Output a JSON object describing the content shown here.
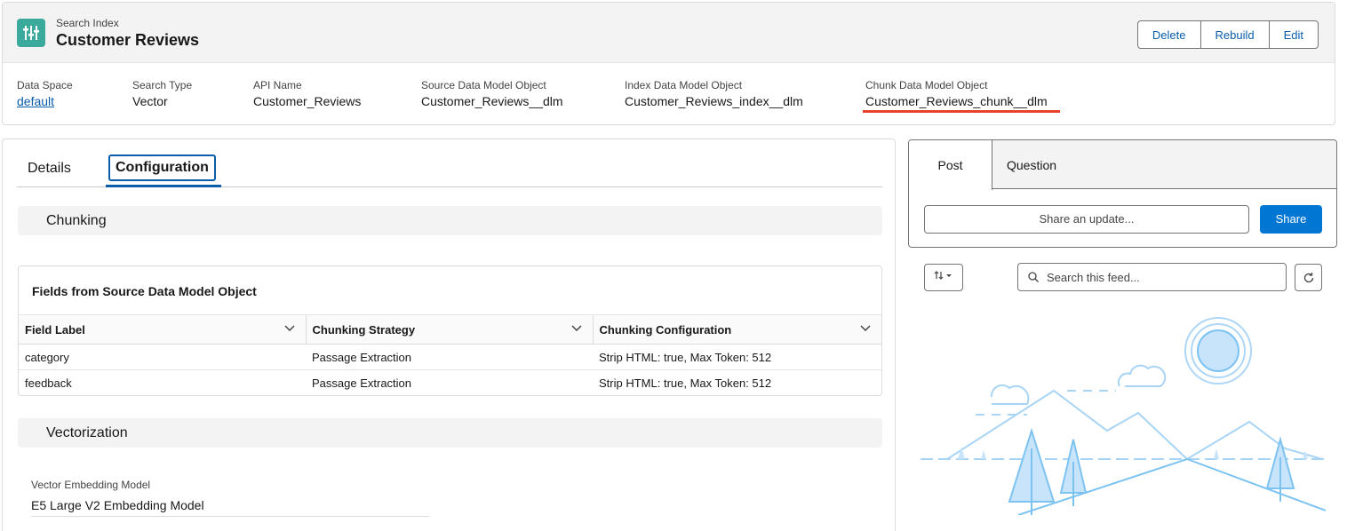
{
  "header": {
    "object_type": "Search Index",
    "title": "Customer Reviews",
    "buttons": {
      "delete": "Delete",
      "rebuild": "Rebuild",
      "edit": "Edit"
    }
  },
  "highlights": [
    {
      "label": "Data Space",
      "value": "default"
    },
    {
      "label": "Search Type",
      "value": "Vector"
    },
    {
      "label": "API Name",
      "value": "Customer_Reviews"
    },
    {
      "label": "Source Data Model Object",
      "value": "Customer_Reviews__dlm"
    },
    {
      "label": "Index Data Model Object",
      "value": "Customer_Reviews_index__dlm"
    },
    {
      "label": "Chunk Data Model Object",
      "value": "Customer_Reviews_chunk__dlm"
    }
  ],
  "tabs": {
    "details": "Details",
    "configuration": "Configuration"
  },
  "chunking": {
    "section_title": "Chunking",
    "table_title": "Fields from Source Data Model Object",
    "columns": [
      "Field Label",
      "Chunking Strategy",
      "Chunking Configuration"
    ],
    "rows": [
      [
        "category",
        "Passage Extraction",
        "Strip HTML: true, Max Token: 512"
      ],
      [
        "feedback",
        "Passage Extraction",
        "Strip HTML: true, Max Token: 512"
      ]
    ]
  },
  "vectorization": {
    "section_title": "Vectorization",
    "model_label": "Vector Embedding Model",
    "model_value": "E5 Large V2 Embedding Model"
  },
  "feed": {
    "tabs": {
      "post": "Post",
      "question": "Question"
    },
    "share_placeholder": "Share an update...",
    "share_button": "Share",
    "search_placeholder": "Search this feed..."
  },
  "colors": {
    "accent": "#0b5cab",
    "brand_button": "#0176d3",
    "icon_bg": "#3ba99c",
    "highlight_underline": "#e8412b"
  }
}
